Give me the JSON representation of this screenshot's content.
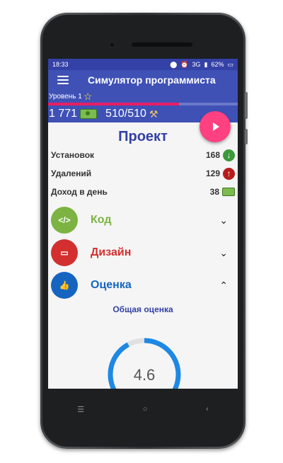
{
  "status_bar": {
    "time": "18:33",
    "network": "3G",
    "battery": "62%"
  },
  "app_bar": {
    "title": "Симулятор программиста"
  },
  "level": {
    "label": "Уровень 1",
    "progress": 0.69
  },
  "stats": {
    "money": "1 771",
    "energy": "510/510"
  },
  "project": {
    "title": "Проект",
    "metrics": [
      {
        "label": "Установок",
        "value": "168",
        "icon": "arrow-down-icon"
      },
      {
        "label": "Удалений",
        "value": "129",
        "icon": "arrow-up-icon"
      },
      {
        "label": "Доход в день",
        "value": "38",
        "icon": "money-icon"
      }
    ]
  },
  "sections": [
    {
      "label": "Код",
      "color": "#7cb342",
      "icon": "code-icon",
      "expanded": false
    },
    {
      "label": "Дизайн",
      "color": "#d32f2f",
      "icon": "monitor-icon",
      "expanded": false
    },
    {
      "label": "Оценка",
      "color": "#1565c0",
      "icon": "thumbs-up-icon",
      "expanded": true
    }
  ],
  "rating": {
    "title": "Общая оценка",
    "value": "4.6",
    "max": 5
  },
  "colors": {
    "primary": "#3f51b5",
    "accent": "#ff4081"
  }
}
